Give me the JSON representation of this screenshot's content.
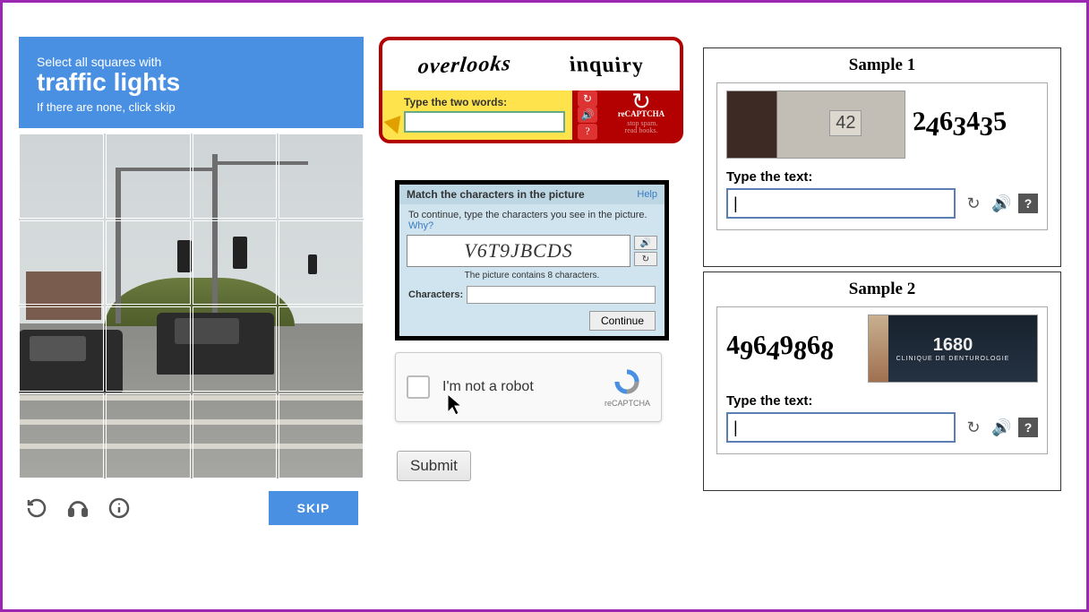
{
  "grid_captcha": {
    "line1": "Select all squares with",
    "target": "traffic lights",
    "line3": "If there are none, click skip",
    "skip_label": "SKIP"
  },
  "classic_recaptcha": {
    "word1": "overlooks",
    "word2": "inquiry",
    "prompt": "Type the two words:",
    "brand": "reCAPTCHA",
    "tagline1": "stop spam.",
    "tagline2": "read books."
  },
  "match_box": {
    "title": "Match the characters in the picture",
    "help": "Help",
    "instruction": "To continue, type the characters you see in the picture.",
    "why": "Why?",
    "captcha_text": "V6T9JBCDS",
    "hint": "The picture contains 8 characters.",
    "input_label": "Characters:",
    "continue_label": "Continue"
  },
  "not_a_robot": {
    "label": "I'm not a robot",
    "brand": "reCAPTCHA"
  },
  "submit_label": "Submit",
  "sample1": {
    "title": "Sample 1",
    "house_number": "42",
    "captcha_digits": "2463435",
    "prompt": "Type the text:",
    "value": "|"
  },
  "sample2": {
    "title": "Sample 2",
    "captcha_digits": "49649868",
    "sign_number": "1680",
    "sign_sub": "CLINIQUE DE DENTUROLOGIE",
    "prompt": "Type the text:",
    "value": "|"
  }
}
